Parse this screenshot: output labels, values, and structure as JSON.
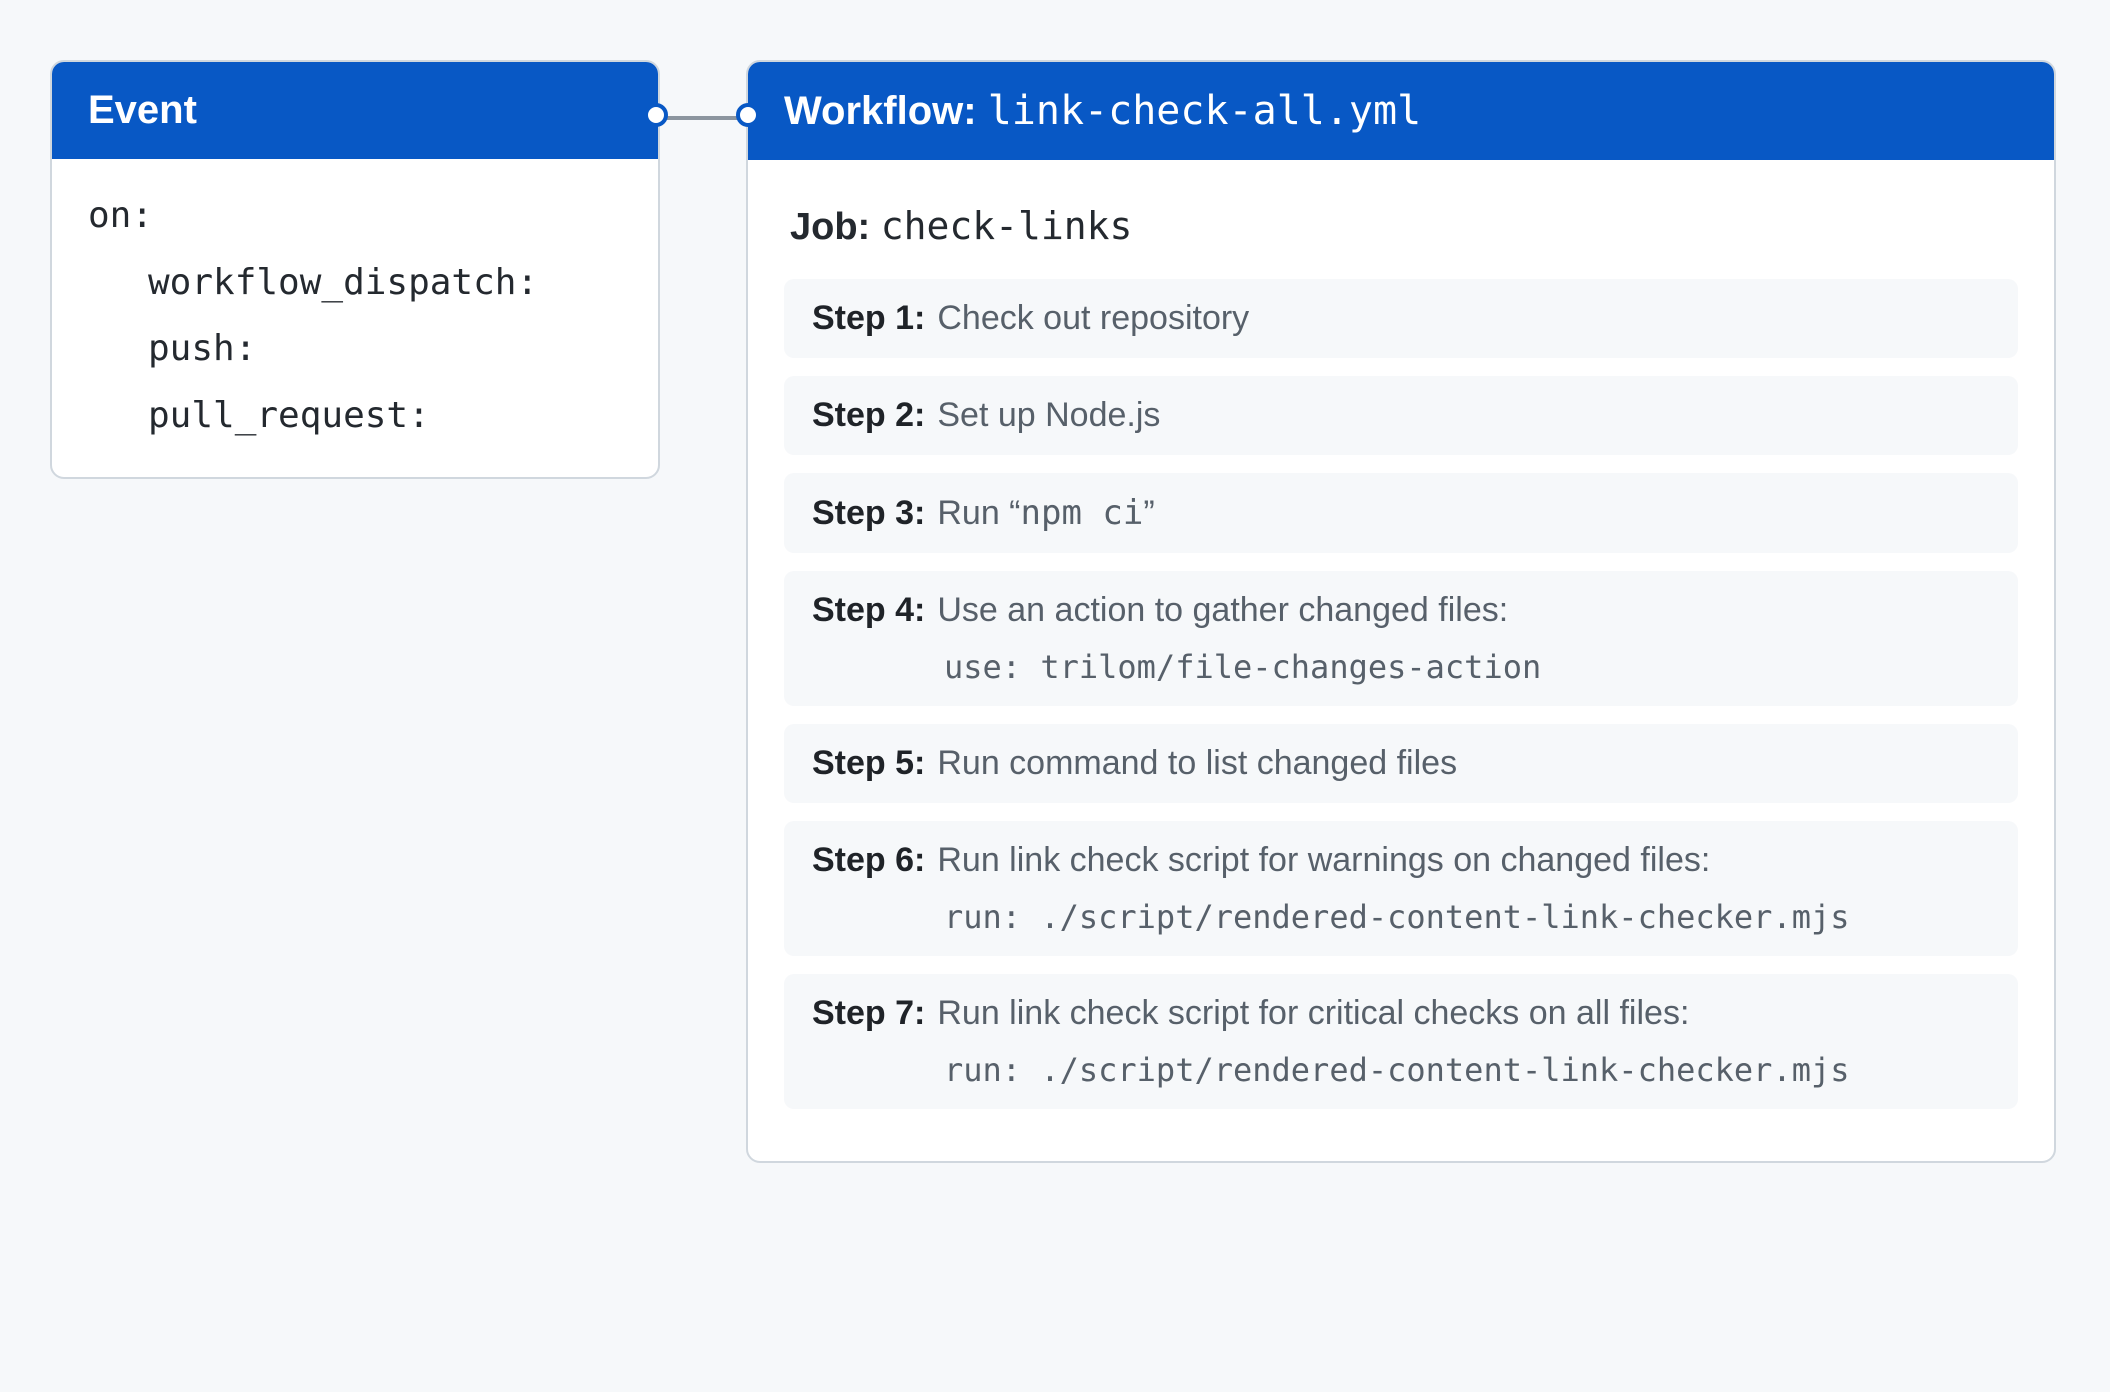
{
  "event": {
    "title": "Event",
    "on_key": "on:",
    "triggers": [
      "workflow_dispatch:",
      "push:",
      "pull_request:"
    ]
  },
  "workflow": {
    "title_label": "Workflow:",
    "filename": "link-check-all.yml",
    "job": {
      "label": "Job:",
      "name": "check-links"
    },
    "steps": [
      {
        "label": "Step 1:",
        "desc_pre": "Check out repository",
        "desc_code": "",
        "desc_post": "",
        "sub": ""
      },
      {
        "label": "Step 2:",
        "desc_pre": "Set up Node.js",
        "desc_code": "",
        "desc_post": "",
        "sub": ""
      },
      {
        "label": "Step 3:",
        "desc_pre": "Run “",
        "desc_code": "npm ci",
        "desc_post": "”",
        "sub": ""
      },
      {
        "label": "Step 4:",
        "desc_pre": "Use an action to gather changed files:",
        "desc_code": "",
        "desc_post": "",
        "sub": "use: trilom/file-changes-action"
      },
      {
        "label": "Step 5:",
        "desc_pre": "Run command to list changed files",
        "desc_code": "",
        "desc_post": "",
        "sub": ""
      },
      {
        "label": "Step 6:",
        "desc_pre": "Run link check script for warnings on changed files:",
        "desc_code": "",
        "desc_post": "",
        "sub": "run: ./script/rendered-content-link-checker.mjs"
      },
      {
        "label": "Step 7:",
        "desc_pre": "Run link check script for critical checks on all files:",
        "desc_code": "",
        "desc_post": "",
        "sub": "run: ./script/rendered-content-link-checker.mjs"
      }
    ]
  }
}
